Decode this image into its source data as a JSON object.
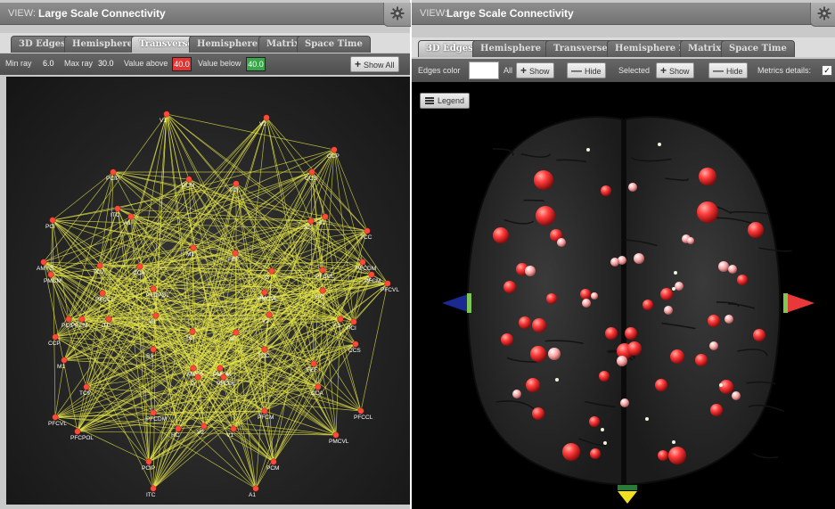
{
  "left": {
    "view_label": "VIEW:",
    "view_title": "Large Scale Connectivity",
    "tabs": [
      "3D Edges",
      "Hemisphere 1",
      "Transverse",
      "Hemisphere 2",
      "Matrix",
      "Space Time"
    ],
    "active_tab": "Transverse",
    "toolbar": {
      "min_ray_label": "Min ray",
      "min_ray_value": "6.0",
      "max_ray_label": "Max ray",
      "max_ray_value": "30.0",
      "value_above_label": "Value above",
      "value_above": "40.0",
      "value_below_label": "Value below",
      "value_below": "40.0",
      "show_all_label": "Show All"
    },
    "node_labels": [
      "rV1",
      "rV2",
      "rTCP",
      "rPCM",
      "rCCR",
      "rCCS",
      "lA1",
      "rA1",
      "rIA",
      "rCC",
      "rIP",
      "rPCI",
      "rCS",
      "rV",
      "rS1",
      "rA2",
      "rTCC",
      "rFEF",
      "rPMCM",
      "rPCS",
      "rPFCDL",
      "rPFCDM",
      "rPFCM",
      "rPFCVL",
      "rPFCCL",
      "rPFCPOL",
      "rG",
      "rPMCVL",
      "rIFCD",
      "rAMYG"
    ],
    "node_labels_drawn": [
      "V1",
      "V2",
      "PCIP",
      "PCM",
      "ITC",
      "A1",
      "PCI",
      "CCP",
      "CCS",
      "TCI",
      "A2",
      "S1",
      "TCC",
      "M1",
      "FEF",
      "AMYG",
      "PMCM",
      "TCV",
      "CCA",
      "G",
      "PFCDL",
      "PFCDM",
      "PFCM",
      "PFCVL",
      "PFCCL",
      "PFCPOL",
      "PMCVL",
      "HC"
    ],
    "colors": {
      "edge": "#e8e84a",
      "node": "#ff4a3a",
      "value_above_bg": "#e53232",
      "value_below_bg": "#3aa64a"
    }
  },
  "right": {
    "view_label": "VIEW:",
    "view_title": "Large Scale Connectivity",
    "tabs": [
      "3D Edges",
      "Hemisphere 1",
      "Transverse",
      "Hemisphere 2",
      "Matrix",
      "Space Time"
    ],
    "active_tab": "3D Edges",
    "toolbar": {
      "edges_color_label": "Edges color",
      "all_label": "All",
      "show_label": "Show",
      "hide_label": "Hide",
      "selected_label": "Selected",
      "show2_label": "Show",
      "hide2_label": "Hide",
      "metrics_label": "Metrics details:",
      "metrics_checked": true
    },
    "legend_label": "Legend",
    "colors": {
      "node": "#ff3b3b",
      "node_light": "#f4a0a0",
      "node_white": "#f2f2dc",
      "brain": "#1e1e1e",
      "axis_x": "#e8383a",
      "axis_y": "#f0e020",
      "axis_neg": "#1a2a90",
      "axis_band": "#7ec850"
    }
  }
}
